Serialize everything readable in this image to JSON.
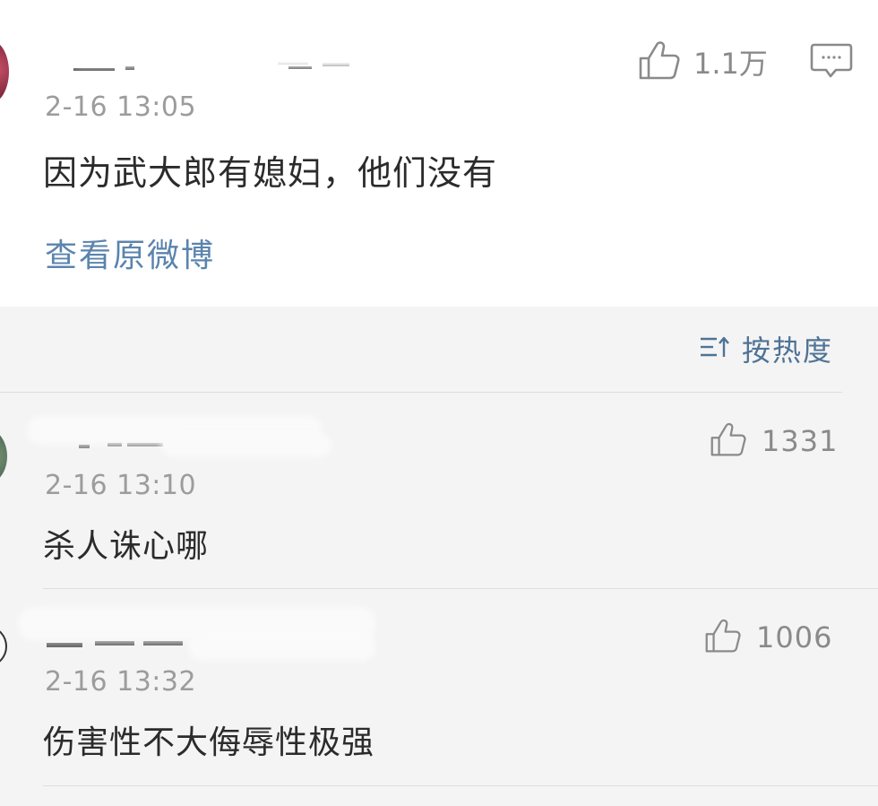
{
  "post": {
    "time": "2-16 13:05",
    "text": "因为武大郎有媳妇，他们没有",
    "like_count": "1.1万",
    "view_original": "查看原微博"
  },
  "sort": {
    "label": "按热度"
  },
  "comments": [
    {
      "time": "2-16 13:10",
      "text": "杀人诛心哪",
      "like_count": "1331"
    },
    {
      "time": "2-16 13:32",
      "text": "伤害性不大侮辱性极强",
      "like_count": "1006"
    }
  ],
  "icons": {
    "like": "thumbs-up-icon",
    "comment": "comment-bubble-icon",
    "sort": "sort-icon"
  },
  "colors": {
    "link": "#5b84ad",
    "sort_text": "#4f7396",
    "meta_text": "#9c9c9c",
    "body_text": "#2b2b2b"
  }
}
